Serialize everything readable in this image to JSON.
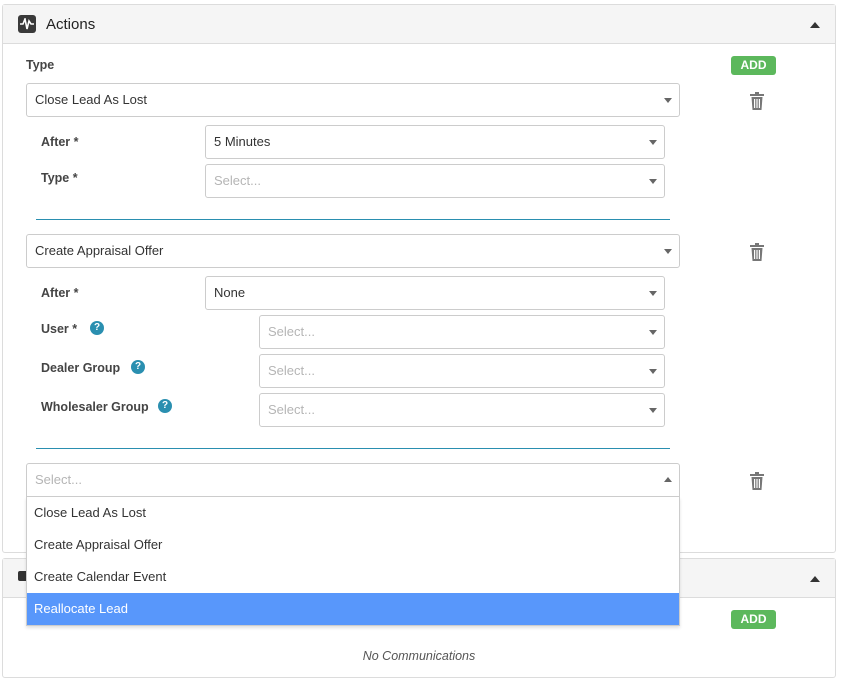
{
  "actions_panel": {
    "title": "Actions",
    "type_label": "Type",
    "add_label": "ADD",
    "rows": [
      {
        "type_value": "Close Lead As Lost",
        "fields": [
          {
            "label": "After *",
            "value": "5 Minutes",
            "placeholder": false
          },
          {
            "label": "Type *",
            "value": "Select...",
            "placeholder": true
          }
        ]
      },
      {
        "type_value": "Create Appraisal Offer",
        "fields": [
          {
            "label": "After *",
            "value": "None",
            "placeholder": false
          },
          {
            "label": "User *",
            "value": "Select...",
            "placeholder": true
          },
          {
            "label": "Dealer Group",
            "value": "Select...",
            "placeholder": true
          },
          {
            "label": "Wholesaler Group",
            "value": "Select...",
            "placeholder": true
          }
        ]
      },
      {
        "type_value": "Select...",
        "dropdown_options": [
          {
            "label": "Close Lead As Lost",
            "active": false
          },
          {
            "label": "Create Appraisal Offer",
            "active": false
          },
          {
            "label": "Create Calendar Event",
            "active": false
          },
          {
            "label": "Reallocate Lead",
            "active": true
          }
        ]
      }
    ]
  },
  "communications_panel": {
    "add_label": "ADD",
    "empty_text": "No Communications"
  },
  "icons": {
    "panel": "activity-icon",
    "collapse": "chevron-up-icon",
    "delete": "trash-icon",
    "help": "question-icon",
    "comms": "comment-icon"
  },
  "colors": {
    "add_button": "#5cb85c",
    "help_icon": "#2a8fb0",
    "divider": "#2a8fb0",
    "highlight": "#5897fb"
  }
}
